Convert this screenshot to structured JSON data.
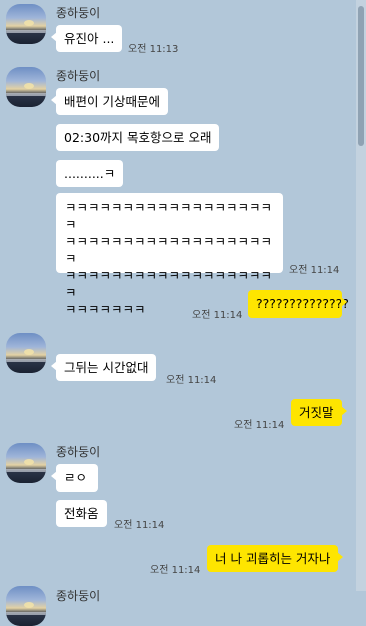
{
  "messages": {
    "g1": {
      "sender": "종하둥이",
      "m1": "유진아 ...",
      "t1": "오전 11:13"
    },
    "g2": {
      "sender": "종하둥이",
      "m1": "배편이 기상때문에",
      "m2": "02:30까지 목호항으로 오래",
      "m3": "..........ㅋ",
      "m4_l1": "ㅋㅋㅋㅋㅋㅋㅋㅋㅋㅋㅋㅋㅋㅋㅋㅋㅋㅋㅋ",
      "m4_l2": "ㅋㅋㅋㅋㅋㅋㅋㅋㅋㅋㅋㅋㅋㅋㅋㅋㅋㅋㅋ",
      "m4_l3": "ㅋㅋㅋㅋㅋㅋㅋㅋㅋㅋㅋㅋㅋㅋㅋㅋㅋㅋㅋ",
      "m4_l4": "ㅋㅋㅋㅋㅋㅋㅋ",
      "t4": "오전 11:14"
    },
    "me1": {
      "text": "??????????????",
      "time": "오전 11:14"
    },
    "g3": {
      "m1": "그뒤는 시간없대",
      "t1": "오전 11:14"
    },
    "me2": {
      "text": "거짓말",
      "time": "오전 11:14"
    },
    "g4": {
      "sender": "종하둥이",
      "m1": "ㄹㅇ",
      "m2": "전화옴",
      "t2": "오전 11:14"
    },
    "me3": {
      "text": "너 나 괴롭히는 거자나",
      "time": "오전 11:14"
    },
    "g5": {
      "sender": "종하둥이"
    }
  }
}
